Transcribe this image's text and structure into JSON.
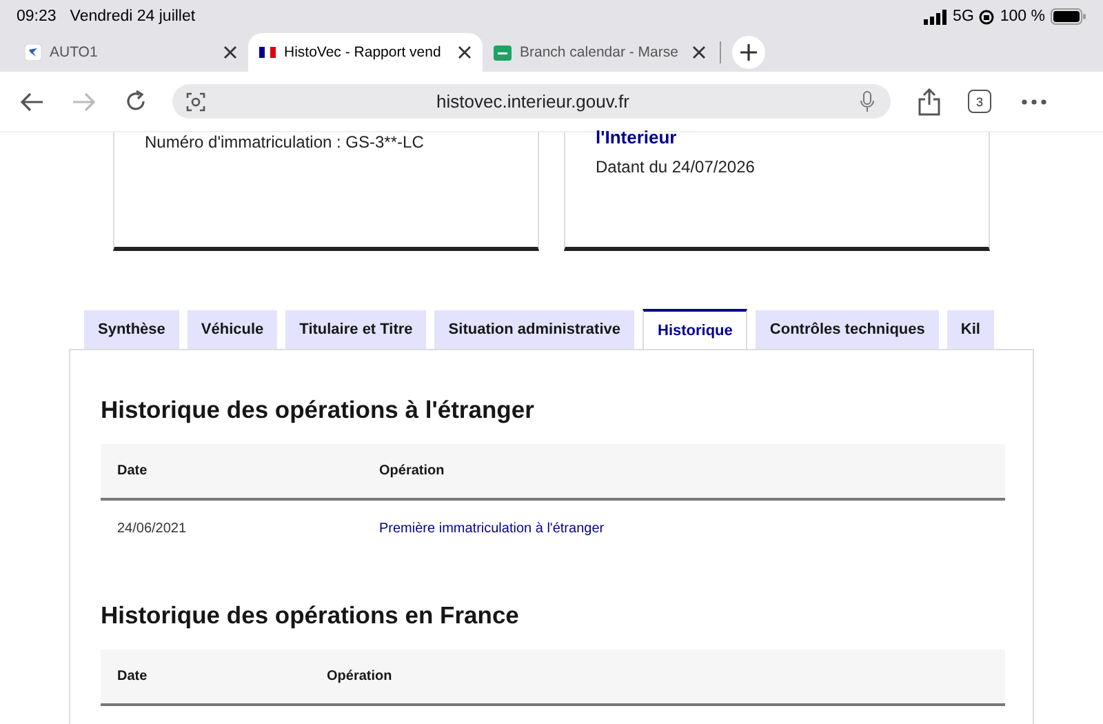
{
  "status_bar": {
    "time": "09:23",
    "date": "Vendredi 24 juillet",
    "network": "5G",
    "battery": "100 %"
  },
  "browser_tabs": [
    {
      "label": "AUTO1",
      "selected": false,
      "kind": "auto"
    },
    {
      "label": "HistoVec - Rapport vend",
      "selected": true,
      "kind": "flag"
    },
    {
      "label": "Branch calendar - Marse",
      "selected": false,
      "kind": "calendar"
    }
  ],
  "toolbar": {
    "url": "histovec.interieur.gouv.fr",
    "tab_count": "3",
    "forward_disabled": true
  },
  "cards": [
    {
      "text": "Numéro d'immatriculation : GS-3**-LC"
    },
    {
      "title": "l'Interieur",
      "text": "Datant du 24/07/2026"
    }
  ],
  "page_tabs": [
    {
      "label": "Synthèse",
      "selected": false
    },
    {
      "label": "Véhicule",
      "selected": false
    },
    {
      "label": "Titulaire et Titre",
      "selected": false
    },
    {
      "label": "Situation administrative",
      "selected": false
    },
    {
      "label": "Historique",
      "selected": true
    },
    {
      "label": "Contrôles techniques",
      "selected": false
    },
    {
      "label": "Kil",
      "selected": false
    }
  ],
  "sections": [
    {
      "title": "Historique des opérations à l'étranger",
      "columns": [
        "Date",
        "Opération"
      ],
      "rows": [
        [
          "24/06/2021",
          "Première immatriculation à l'étranger"
        ]
      ]
    },
    {
      "title": "Historique des opérations en France",
      "columns": [
        "Date",
        "Opération"
      ]
    }
  ]
}
